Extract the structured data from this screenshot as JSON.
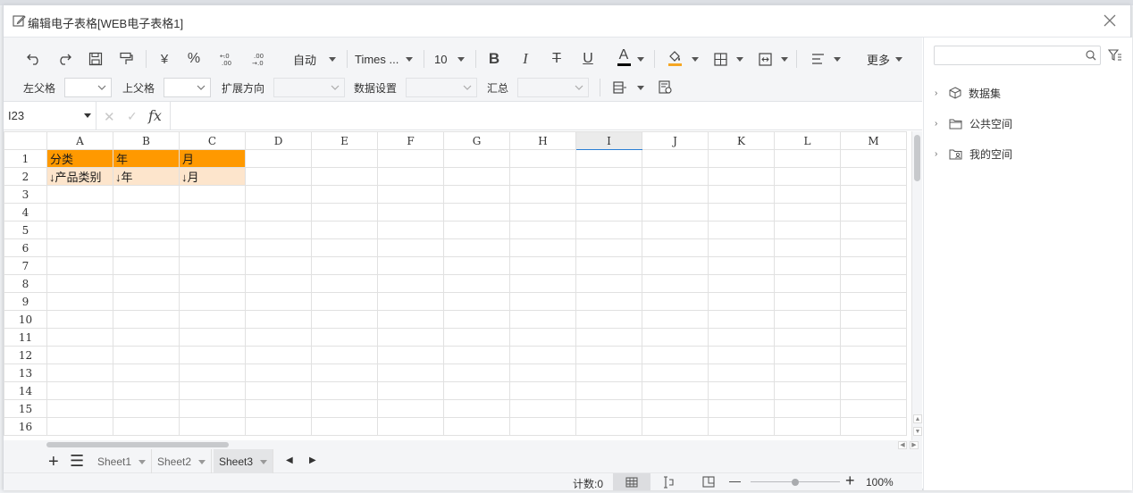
{
  "dialog": {
    "title": "编辑电子表格[WEB电子表格1]"
  },
  "toolbar": {
    "currency_symbol": "¥",
    "percent_symbol": "%",
    "inc_decimal": "+.0 .00",
    "dec_decimal": ".00 +.0",
    "format_value": "自动",
    "font_family": "Times ...",
    "font_size": "10",
    "bold": "B",
    "italic": "I",
    "strike": "T",
    "underline": "U",
    "font_color_letter": "A",
    "font_color": "#000000",
    "fill_color": "#f5a623",
    "more_label": "更多"
  },
  "bindbar": {
    "left_parent_label": "左父格",
    "top_parent_label": "上父格",
    "expand_label": "扩展方向",
    "data_setting_label": "数据设置",
    "summary_label": "汇总"
  },
  "formula": {
    "cell_ref": "I23",
    "cancel": "✕",
    "confirm": "✓",
    "fx": "fx",
    "value": ""
  },
  "grid": {
    "columns": [
      "A",
      "B",
      "C",
      "D",
      "E",
      "F",
      "G",
      "H",
      "I",
      "J",
      "K",
      "L",
      "M"
    ],
    "rows": [
      "1",
      "2",
      "3",
      "4",
      "5",
      "6",
      "7",
      "8",
      "9",
      "10",
      "11",
      "12",
      "13",
      "14",
      "15",
      "16"
    ],
    "active_column": "I",
    "cells": [
      [
        "分类",
        "年",
        "月"
      ],
      [
        "↓产品类别",
        "↓年",
        "↓月"
      ]
    ],
    "header_fill": "#ff9900",
    "field_fill": "#fde5cc"
  },
  "sheets": {
    "add": "+",
    "list": "☰",
    "tabs": [
      "Sheet1",
      "Sheet2",
      "Sheet3"
    ],
    "active": "Sheet3"
  },
  "status": {
    "count_label": "计数:0",
    "zoom_minus": "—",
    "zoom_plus": "+",
    "zoom": "100%",
    "zoom_level": 0.5
  },
  "panel": {
    "search_placeholder": "",
    "items": [
      {
        "label": "数据集",
        "icon": "cube-icon"
      },
      {
        "label": "公共空间",
        "icon": "folder-icon"
      },
      {
        "label": "我的空间",
        "icon": "user-folder-icon"
      }
    ]
  }
}
